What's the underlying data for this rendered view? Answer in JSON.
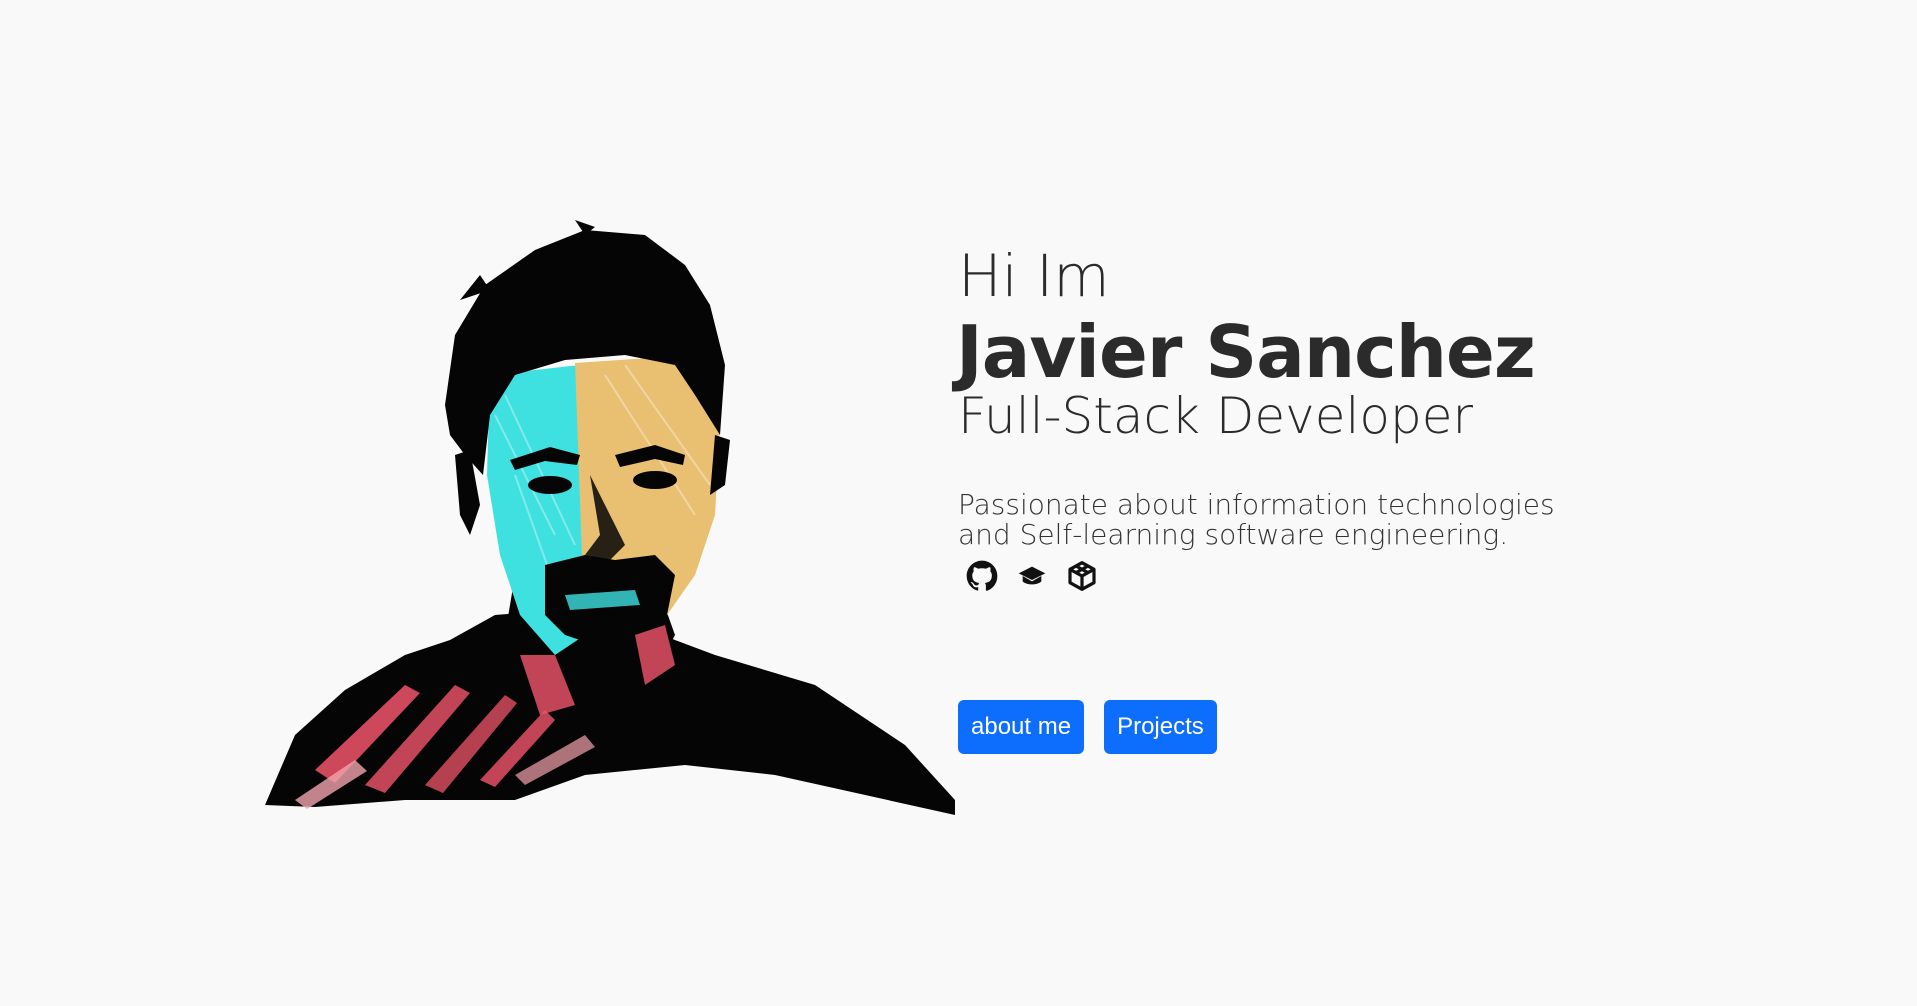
{
  "hero": {
    "greeting": "Hi Im",
    "name": "Javier Sanchez",
    "role": "Full-Stack Developer",
    "tagline_line1": "Passionate about information technologies",
    "tagline_line2": "and Self-learning software engineering."
  },
  "socials": [
    {
      "icon": "github-icon"
    },
    {
      "icon": "education-icon"
    },
    {
      "icon": "codesandbox-icon"
    }
  ],
  "buttons": {
    "about_label": "about me",
    "projects_label": "Projects"
  },
  "colors": {
    "background": "#f9f9f9",
    "text": "#2b2b2b",
    "button": "#0d6efd",
    "portrait_cyan": "#3fe0e0",
    "portrait_orange": "#e9bf72",
    "portrait_red": "#f0556a"
  }
}
